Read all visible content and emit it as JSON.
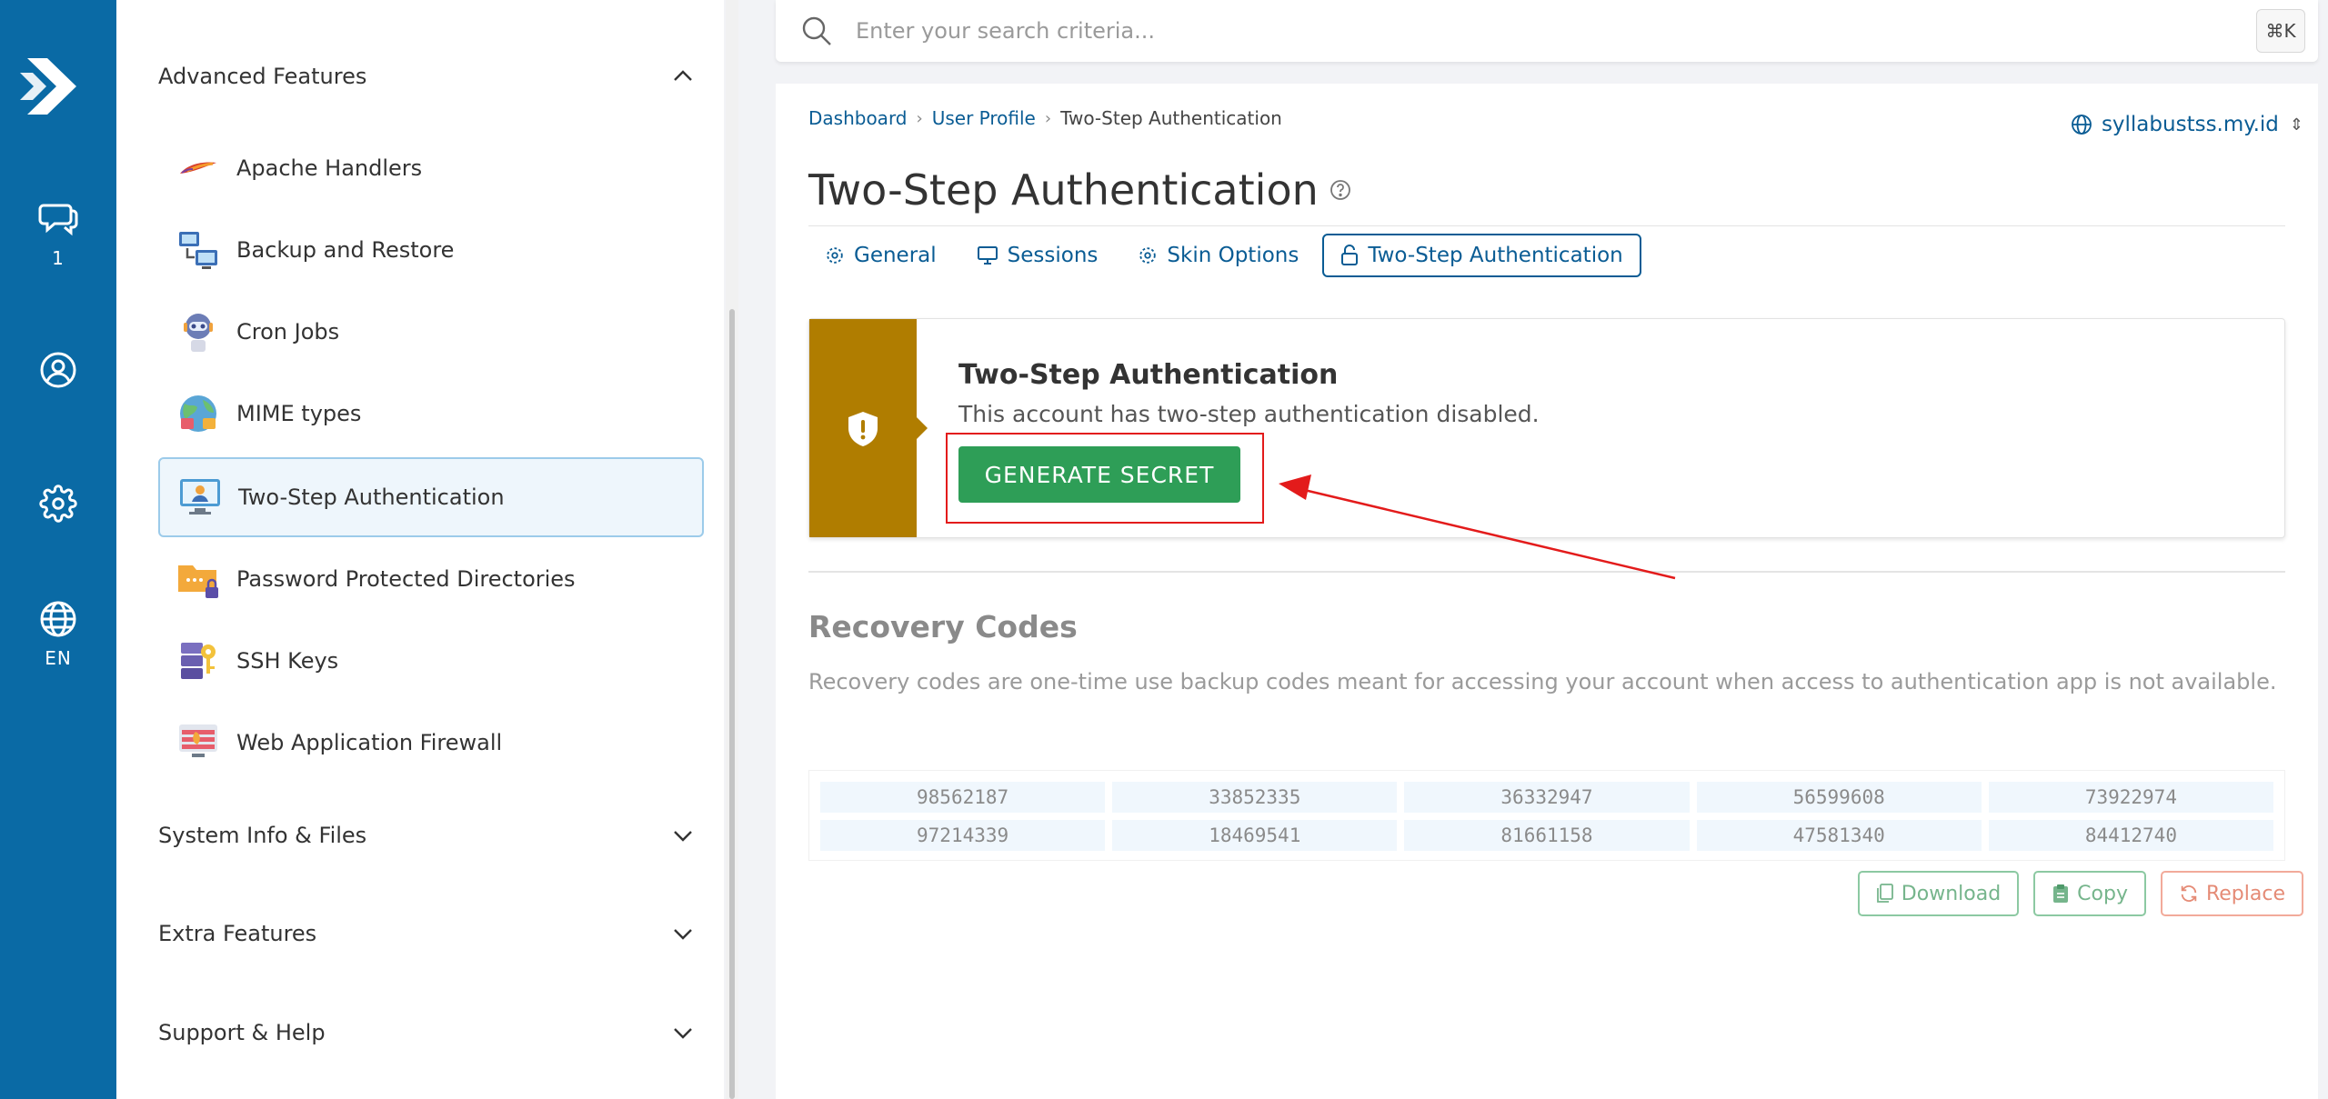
{
  "rail": {
    "chat_badge": "1",
    "lang": "EN"
  },
  "sidebar": {
    "groups": [
      {
        "label": "Advanced Features"
      },
      {
        "label": "System Info & Files"
      },
      {
        "label": "Extra Features"
      },
      {
        "label": "Support & Help"
      }
    ],
    "items": [
      {
        "label": "Apache Handlers"
      },
      {
        "label": "Backup and Restore"
      },
      {
        "label": "Cron Jobs"
      },
      {
        "label": "MIME types"
      },
      {
        "label": "Two-Step Authentication"
      },
      {
        "label": "Password Protected Directories"
      },
      {
        "label": "SSH Keys"
      },
      {
        "label": "Web Application Firewall"
      }
    ]
  },
  "search": {
    "placeholder": "Enter your search criteria...",
    "shortcut": "⌘K"
  },
  "breadcrumb": {
    "items": [
      "Dashboard",
      "User Profile",
      "Two-Step Authentication"
    ]
  },
  "domain": "syllabustss.my.id",
  "page": {
    "title": "Two-Step Authentication"
  },
  "tabs": [
    {
      "label": "General"
    },
    {
      "label": "Sessions"
    },
    {
      "label": "Skin Options"
    },
    {
      "label": "Two-Step Authentication"
    }
  ],
  "alert": {
    "title": "Two-Step Authentication",
    "text": "This account has two-step authentication disabled.",
    "button": "GENERATE SECRET"
  },
  "recovery": {
    "title": "Recovery Codes",
    "description": "Recovery codes are one-time use backup codes meant for accessing your account when access to authentication app is not available.",
    "codes": [
      "98562187",
      "33852335",
      "36332947",
      "56599608",
      "73922974",
      "97214339",
      "18469541",
      "81661158",
      "47581340",
      "84412740"
    ],
    "download": "Download",
    "copy": "Copy",
    "replace": "Replace"
  },
  "colors": {
    "rail": "#0a6aa5",
    "accent": "#0a5c94",
    "warning_band": "#b07d00",
    "success": "#2e9e57",
    "annotation": "#e31b1b"
  }
}
